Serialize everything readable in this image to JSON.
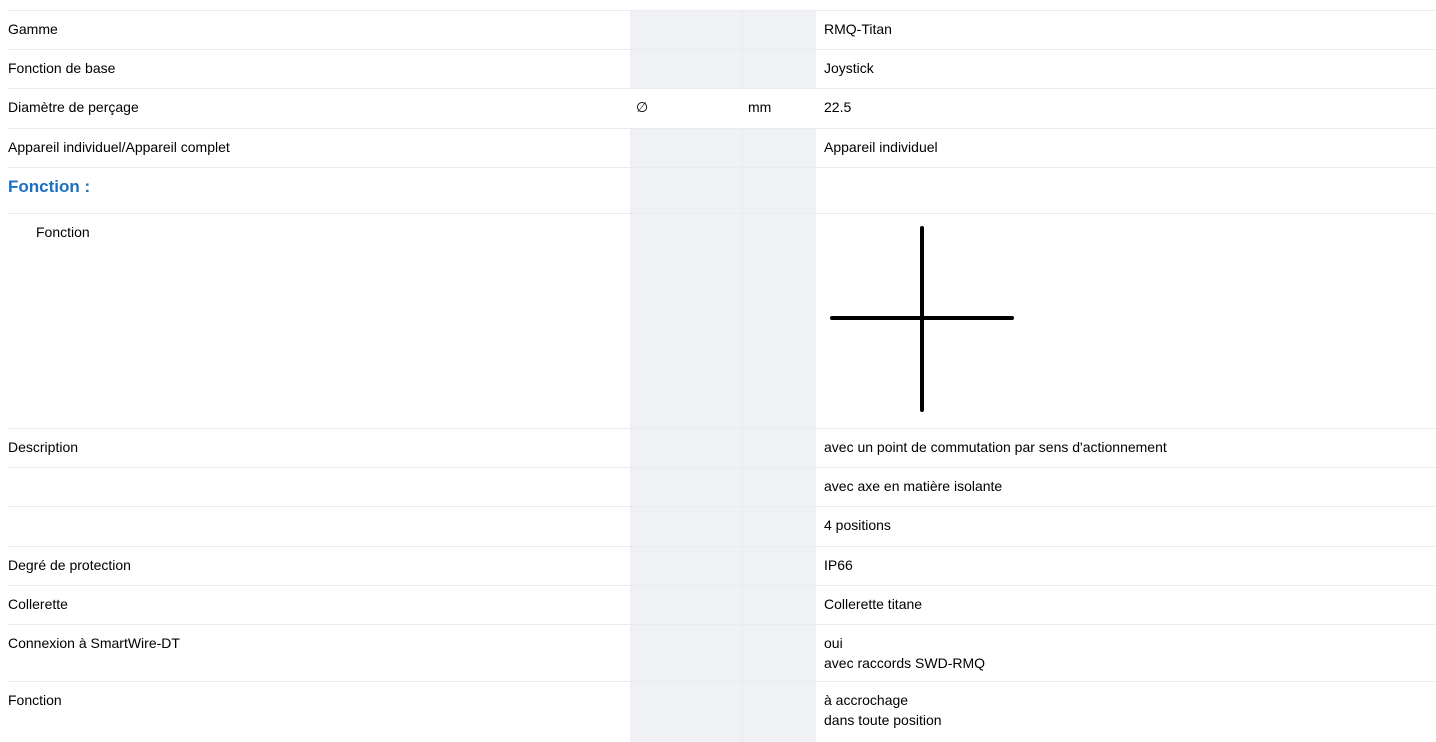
{
  "rows": [
    {
      "label": "Gamme",
      "symbol": "",
      "unit": "",
      "value": [
        "RMQ-Titan"
      ]
    },
    {
      "label": "Fonction de base",
      "symbol": "",
      "unit": "",
      "value": [
        "Joystick"
      ]
    },
    {
      "label": "Diamètre de perçage",
      "symbol": "∅",
      "unit": "mm",
      "value": [
        "22.5"
      ]
    },
    {
      "label": "Appareil individuel/Appareil complet",
      "symbol": "",
      "unit": "",
      "value": [
        "Appareil individuel"
      ]
    }
  ],
  "section": {
    "title": "Fonction :"
  },
  "function_row": {
    "label": "Fonction",
    "icon": "joystick-cross-icon"
  },
  "rows2": [
    {
      "label": "Description",
      "value": [
        "avec un point de commutation par sens d'actionnement"
      ]
    },
    {
      "label": "",
      "value": [
        "avec axe en matière isolante"
      ]
    },
    {
      "label": "",
      "value": [
        "4 positions"
      ]
    },
    {
      "label": "Degré de protection",
      "value": [
        "IP66"
      ]
    },
    {
      "label": "Collerette",
      "value": [
        "Collerette titane"
      ]
    },
    {
      "label": "Connexion à SmartWire-DT",
      "value": [
        "oui",
        "avec raccords SWD-RMQ"
      ]
    },
    {
      "label": "Fonction",
      "value": [
        "à accrochage",
        "dans toute position"
      ]
    }
  ]
}
